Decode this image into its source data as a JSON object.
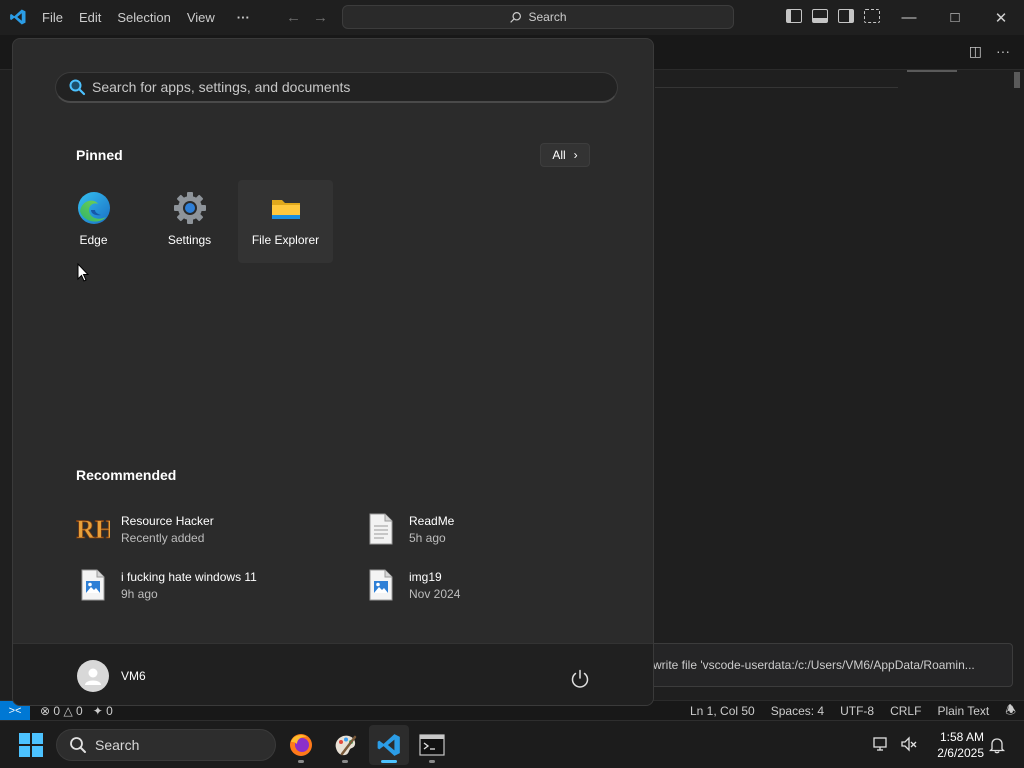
{
  "vscode": {
    "menu": [
      "File",
      "Edit",
      "Selection",
      "View",
      "···"
    ],
    "search_label": "Search",
    "window_controls": [
      "minimize-icon",
      "maximize-icon",
      "close-icon"
    ],
    "notification": "write file 'vscode-userdata:/c:/Users/VM6/AppData/Roamin...",
    "status": {
      "errors": "0",
      "warnings": "0",
      "ports": "0",
      "position": "Ln 1, Col 50",
      "spaces": "Spaces: 4",
      "encoding": "UTF-8",
      "eol": "CRLF",
      "language": "Plain Text"
    }
  },
  "start_menu": {
    "search_placeholder": "Search for apps, settings, and documents",
    "pinned_title": "Pinned",
    "all_label": "All",
    "pinned": [
      {
        "label": "Edge",
        "icon": "edge-icon"
      },
      {
        "label": "Settings",
        "icon": "settings-gear-icon"
      },
      {
        "label": "File Explorer",
        "icon": "folder-icon"
      }
    ],
    "recommended_title": "Recommended",
    "recommended": [
      {
        "name": "Resource Hacker",
        "sub": "Recently added",
        "icon": "resource-hacker-icon"
      },
      {
        "name": "ReadMe",
        "sub": "5h ago",
        "icon": "document-icon"
      },
      {
        "name": "i fucking hate windows 11",
        "sub": "9h ago",
        "icon": "image-file-icon"
      },
      {
        "name": "img19",
        "sub": "Nov 2024",
        "icon": "image-file-icon"
      }
    ],
    "user_name": "VM6"
  },
  "taskbar": {
    "search_label": "Search",
    "apps": [
      "firefox-icon",
      "paint-icon",
      "vscode-icon",
      "terminal-icon"
    ],
    "time": "1:58 AM",
    "date": "2/6/2025"
  },
  "colors": {
    "accent": "#4cc2ff",
    "vscode_blue": "#0078d4",
    "start_bg": "#2b2b2b"
  }
}
